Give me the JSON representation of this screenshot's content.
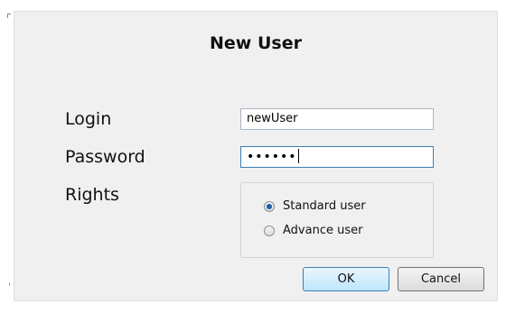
{
  "dialog": {
    "title": "New User",
    "fields": {
      "login_label": "Login",
      "login_value": "newUser",
      "password_label": "Password",
      "password_value": "••••••",
      "rights_label": "Rights"
    },
    "rights_options": [
      {
        "label": "Standard user",
        "checked": true
      },
      {
        "label": "Advance user",
        "checked": false
      }
    ],
    "buttons": {
      "ok_label": "OK",
      "cancel_label": "Cancel"
    }
  },
  "colors": {
    "dialog_bg": "#f0f0f0",
    "focus_border": "#3c7fb1",
    "radio_dot": "#1e5da6"
  }
}
